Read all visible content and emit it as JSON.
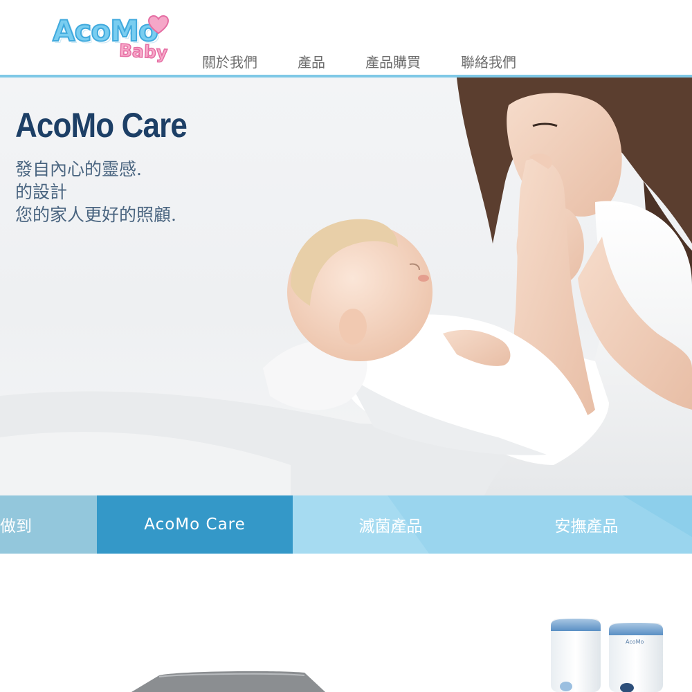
{
  "brand": {
    "logo_main": "AcoMo",
    "logo_sub": "Baby",
    "colors": {
      "accent": "#7ec8e6",
      "logo_blue": "#79cdf0",
      "logo_pink": "#f7a8c9",
      "title": "#1d3f66",
      "tab_active": "#3498c8"
    }
  },
  "nav": {
    "items": [
      {
        "label": "關於我們"
      },
      {
        "label": "產品"
      },
      {
        "label": "產品購買"
      },
      {
        "label": "聯絡我們"
      }
    ]
  },
  "hero": {
    "title": "AcoMo Care",
    "lines": [
      "發自內心的靈感.",
      "的設計",
      "您的家人更好的照顧."
    ]
  },
  "tabs": [
    {
      "label": "做到",
      "active": false
    },
    {
      "label": "AcoMo Care",
      "active": true
    },
    {
      "label": "滅菌產品",
      "active": false
    },
    {
      "label": "安撫產品",
      "active": false
    }
  ],
  "products": {
    "device_label": "AcoMo"
  }
}
